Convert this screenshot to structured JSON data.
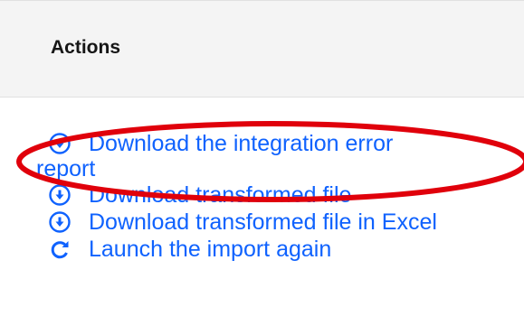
{
  "section": {
    "title": "Actions"
  },
  "actions": [
    {
      "id": "download-error-report",
      "icon": "download-circle-icon",
      "label_line1": "Download the integration error",
      "label_line2": "report"
    },
    {
      "id": "download-transformed",
      "icon": "download-circle-icon",
      "label": "Download transformed file"
    },
    {
      "id": "download-transformed-excel",
      "icon": "download-circle-icon",
      "label": "Download transformed file in Excel"
    },
    {
      "id": "launch-import-again",
      "icon": "refresh-icon",
      "label": "Launch the import again"
    }
  ],
  "colors": {
    "link": "#0f62fe",
    "annotation": "#e0000b",
    "header_bg": "#f4f4f4",
    "text": "#161616"
  }
}
